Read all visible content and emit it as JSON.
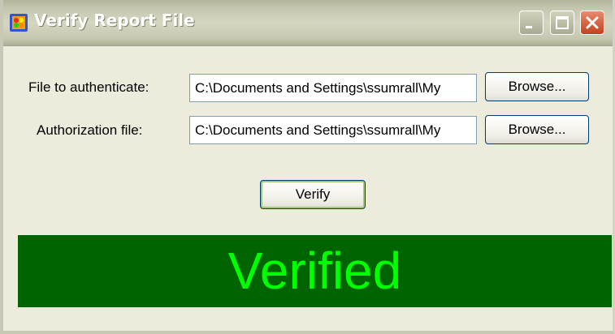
{
  "window": {
    "title": "Verify Report File",
    "icon": "traffic-light-app-icon"
  },
  "form": {
    "file_label": "File to authenticate:",
    "file_value": "C:\\Documents and Settings\\ssumrall\\My",
    "auth_label": "Authorization file:",
    "auth_value": "C:\\Documents and Settings\\ssumrall\\My",
    "browse_label": "Browse...",
    "verify_label": "Verify"
  },
  "status": {
    "text": "Verified",
    "background": "#006400",
    "color": "#00ff00"
  }
}
